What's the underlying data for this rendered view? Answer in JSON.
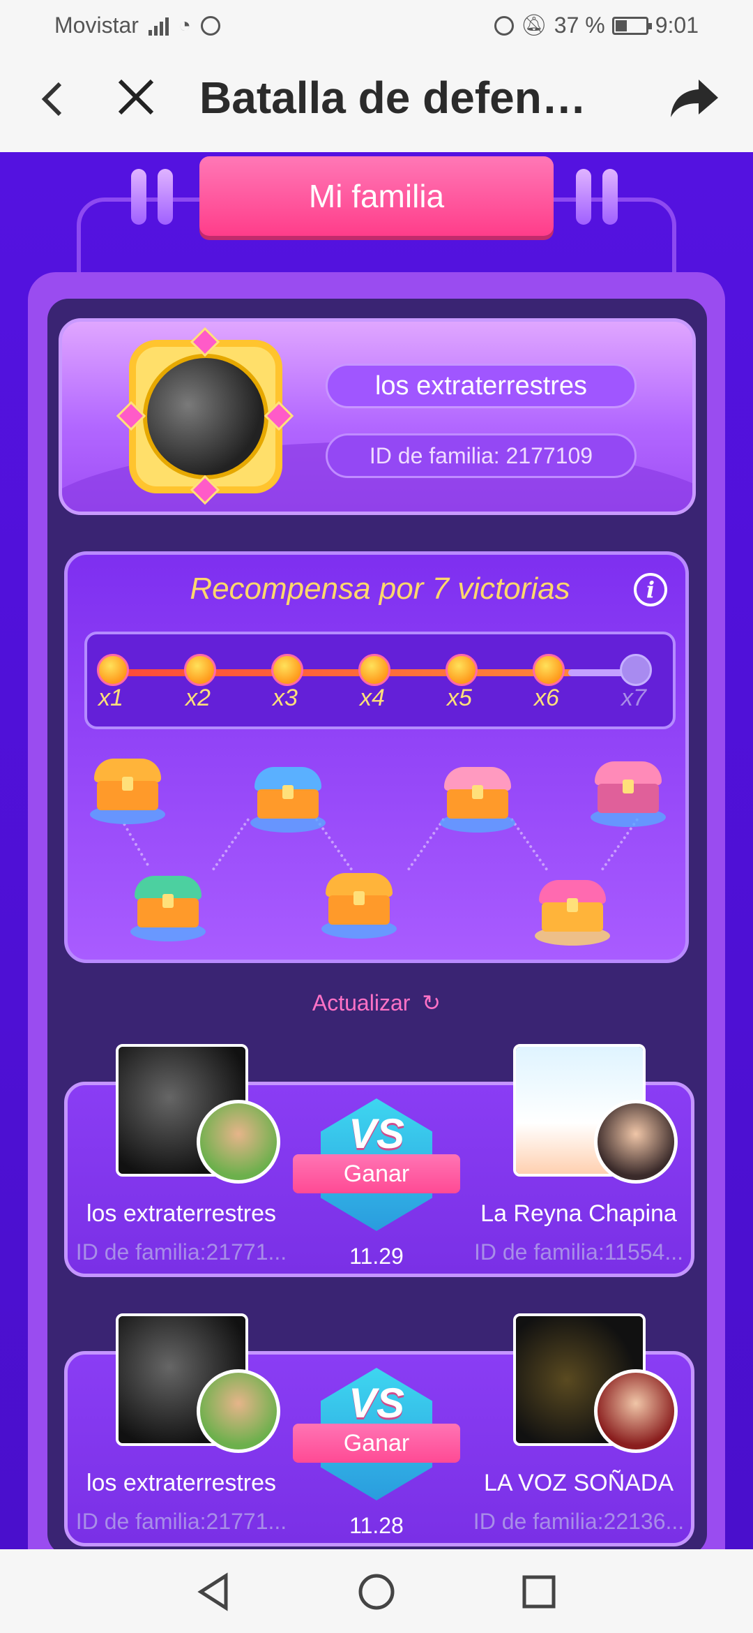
{
  "status_bar": {
    "carrier": "Movistar",
    "battery": "37 %",
    "battery_level": 0.37,
    "time": "9:01"
  },
  "app_bar": {
    "title": "Batalla de defen…"
  },
  "tab": {
    "label": "Mi familia"
  },
  "family": {
    "name": "los extraterrestres",
    "id_label": "ID de familia: 2177109"
  },
  "reward": {
    "title": "Recompensa por 7 victorias",
    "steps": [
      "x1",
      "x2",
      "x3",
      "x4",
      "x5",
      "x6",
      "x7"
    ]
  },
  "refresh_label": "Actualizar",
  "matches": [
    {
      "left_name": "los extraterrestres",
      "left_id": "ID de familia:21771...",
      "vs": "VS",
      "result": "Ganar",
      "date": "11.29",
      "right_name": "La Reyna Chapina",
      "right_id": "ID de familia:11554..."
    },
    {
      "left_name": "los extraterrestres",
      "left_id": "ID de familia:21771...",
      "vs": "VS",
      "result": "Ganar",
      "date": "11.28",
      "right_name": "LA VOZ SOÑADA",
      "right_id": "ID de familia:22136..."
    }
  ],
  "icons": {
    "back": "chevron-left-icon",
    "close": "close-icon",
    "share": "share-icon",
    "info": "info-icon",
    "refresh": "refresh-icon",
    "nav_back": "triangle-back-icon",
    "nav_home": "circle-home-icon",
    "nav_recent": "square-recent-icon"
  },
  "colors": {
    "accent_pink": "#ff3d8a",
    "background_purple": "#4a10d0",
    "gold_text": "#ffd86b"
  }
}
